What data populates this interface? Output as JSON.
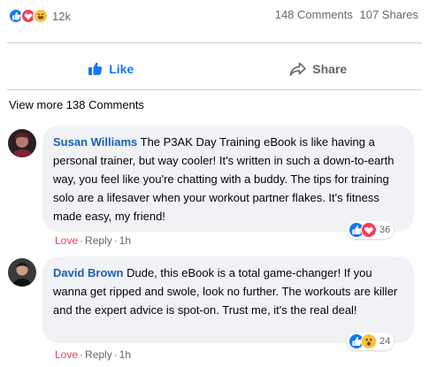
{
  "post_stats": {
    "reaction_count": "12k",
    "comments": "148 Comments",
    "shares": "107 Shares"
  },
  "actions": {
    "like_label": "Like",
    "share_label": "Share"
  },
  "view_more": "View more 138 Comments",
  "comments": [
    {
      "author": "Susan Williams",
      "text": "The P3AK Day Training eBook is like having a personal trainer, but way cooler! It's written in such a down-to-earth way, you feel like you're chatting with a buddy. The tips for training solo are a lifesaver when your workout partner flakes. It's fitness made easy, my friend!",
      "reaction_count": "36",
      "reactions": [
        "like-icon",
        "love-icon"
      ],
      "love_label": "Love",
      "reply_label": "Reply",
      "time": "1h"
    },
    {
      "author": "David Brown",
      "text": "Dude, this eBook is a total game-changer! If you wanna get ripped and swole, look no further. The workouts are killer and the expert advice is spot-on. Trust me, it's the real deal!",
      "reaction_count": "24",
      "reactions": [
        "like-icon",
        "wow-icon"
      ],
      "love_label": "Love",
      "reply_label": "Reply",
      "time": "1h"
    }
  ],
  "colors": {
    "like_blue": "#1877f2",
    "love_red": "#f33e58",
    "author_blue": "#1c5fb6",
    "bubble_bg": "#f0f2f5",
    "meta_love": "#e4405f"
  }
}
